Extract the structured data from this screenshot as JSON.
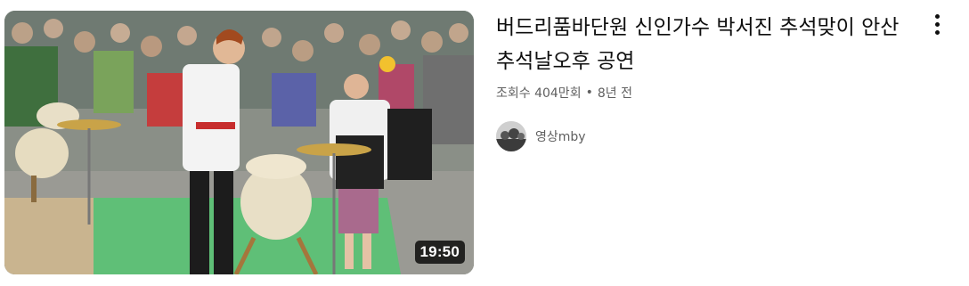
{
  "video": {
    "title": "버드리품바단원 신인가수 박서진 추석맞이 안산 추석날오후 공연",
    "views": "조회수 404만회",
    "separator": "•",
    "age": "8년 전",
    "duration": "19:50",
    "channel": {
      "name": "영상mby"
    }
  },
  "icons": {
    "more": "more-vert-icon"
  },
  "colors": {
    "title": "#0f0f0f",
    "meta": "#606060",
    "duration_bg": "#000000",
    "duration_text": "#ffffff"
  }
}
